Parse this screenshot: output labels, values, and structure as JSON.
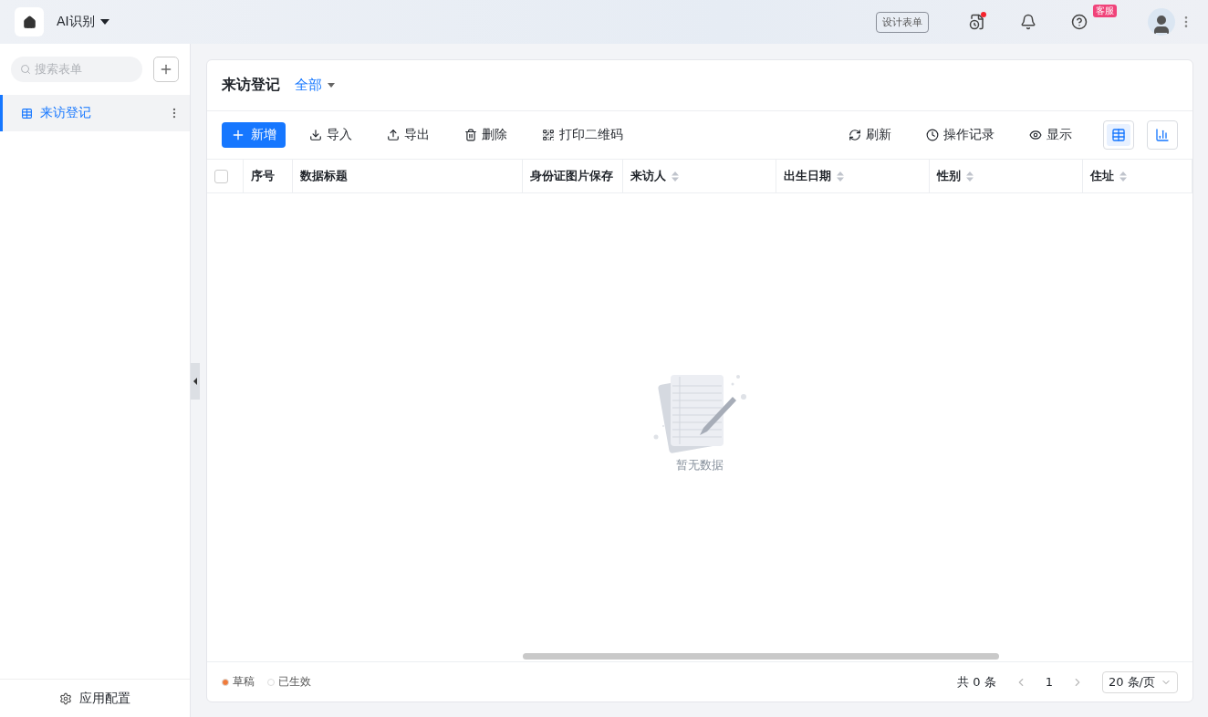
{
  "header": {
    "app_name": "AI识别",
    "design_button": "设计表单",
    "has_unread": true,
    "help_badge": "客服"
  },
  "sidebar": {
    "search": {
      "placeholder": "搜索表单"
    },
    "items": [
      {
        "label": "来访登记",
        "selected": true
      }
    ],
    "footer": "应用配置"
  },
  "page": {
    "title": "来访登记",
    "filter": "全部"
  },
  "toolbar": {
    "left": [
      {
        "kind": "primary",
        "label": "新增"
      },
      {
        "kind": "import",
        "label": "导入"
      },
      {
        "kind": "export",
        "label": "导出"
      },
      {
        "kind": "delete",
        "label": "删除"
      },
      {
        "kind": "qrcode",
        "label": "打印二维码"
      }
    ],
    "right": [
      {
        "kind": "refresh",
        "label": "刷新"
      },
      {
        "kind": "history",
        "label": "操作记录"
      },
      {
        "kind": "display",
        "label": "显示"
      }
    ],
    "views": [
      {
        "kind": "table",
        "selected": true
      },
      {
        "kind": "chart",
        "selected": false
      }
    ]
  },
  "table": {
    "select_all_checked": false,
    "columns": [
      {
        "label": "序号",
        "sortable": false
      },
      {
        "label": "数据标题",
        "sortable": false
      },
      {
        "label": "身份证图片保存",
        "sortable": false
      },
      {
        "label": "来访人",
        "sortable": true
      },
      {
        "label": "出生日期",
        "sortable": true
      },
      {
        "label": "性别",
        "sortable": true
      },
      {
        "label": "住址",
        "sortable": true
      }
    ],
    "empty_text": "暂无数据"
  },
  "legend": [
    {
      "label": "草稿",
      "color": "#f07a3a"
    },
    {
      "label": "已生效",
      "color": "#ffffff"
    }
  ],
  "pagination": {
    "total": "共 0 条",
    "pages": [
      {
        "label": "1",
        "selected": true
      }
    ],
    "page_size": "20 条/页"
  }
}
